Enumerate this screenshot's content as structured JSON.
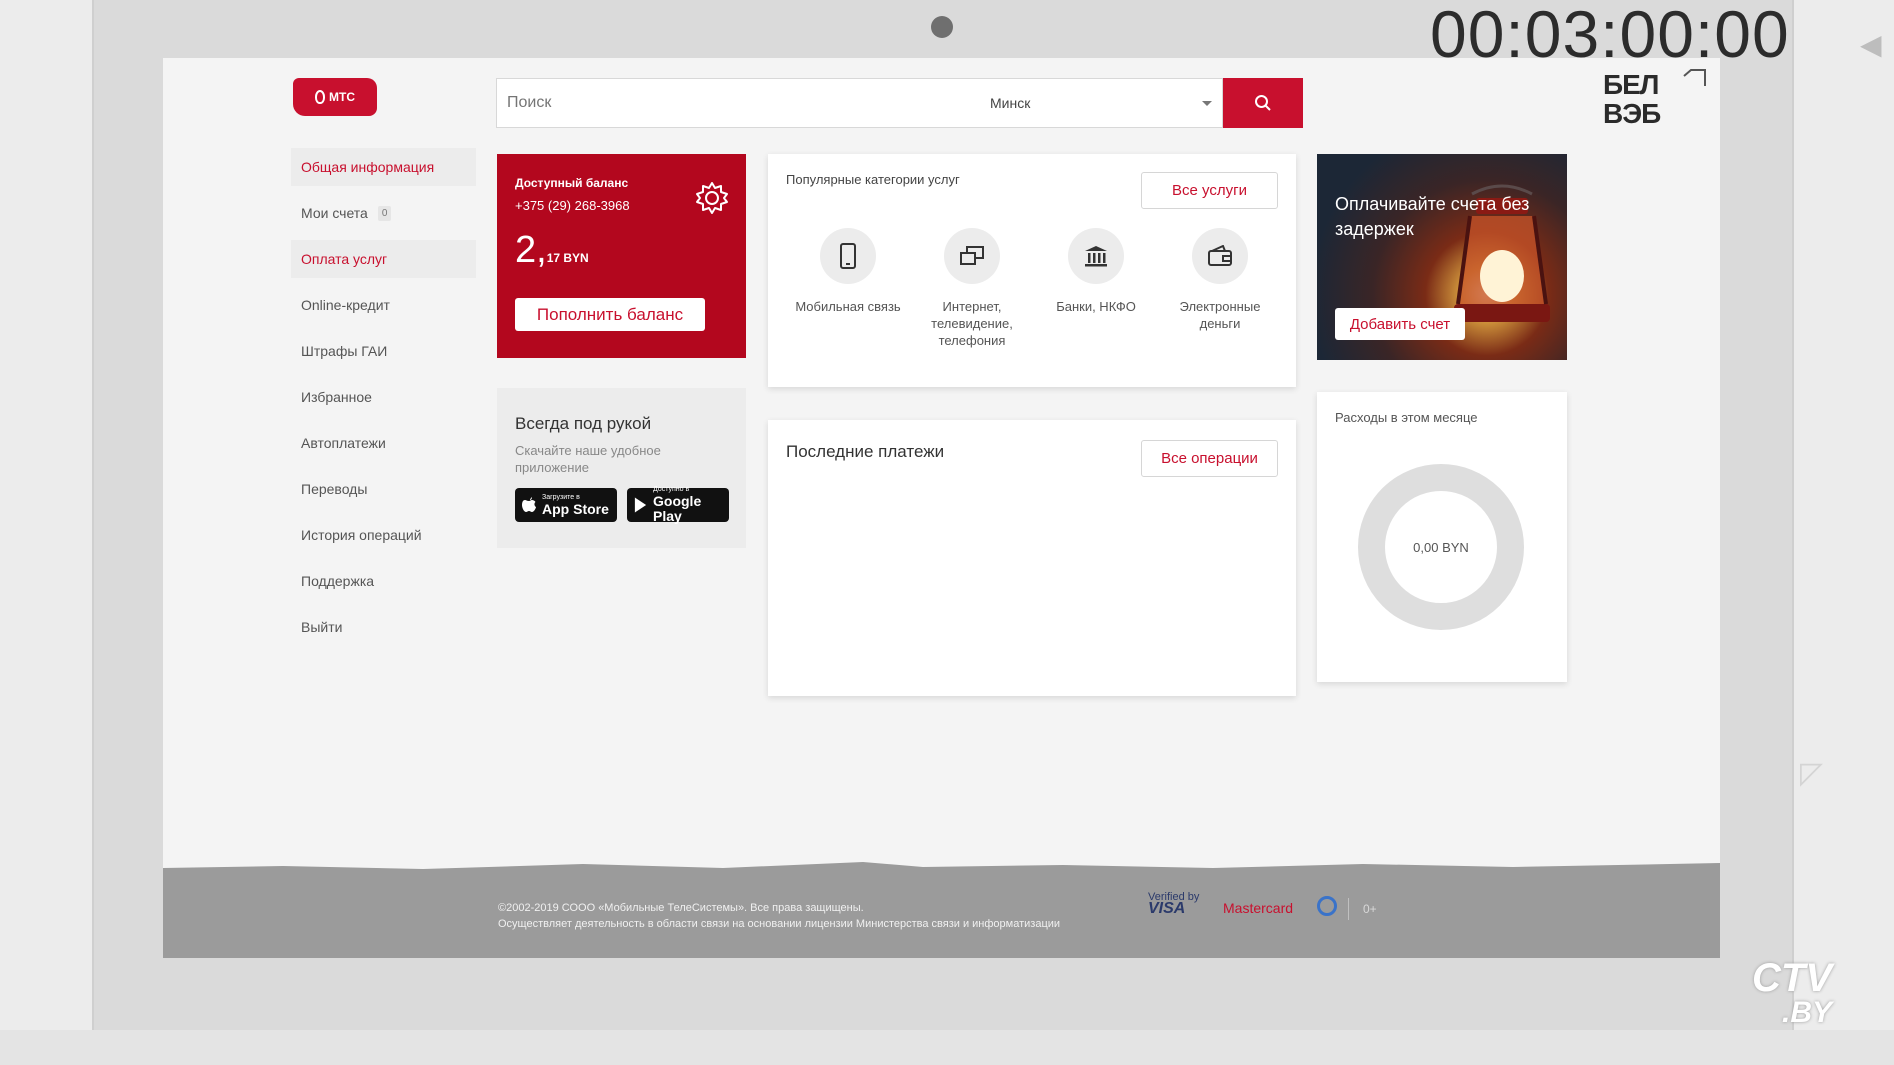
{
  "overlay": {
    "timecode": "00:03:00:00",
    "channel_logo": "CTV",
    "channel_logo_suffix": ".BY"
  },
  "header": {
    "logo_text": "МТС",
    "search_placeholder": "Поиск",
    "city": "Минск",
    "search_icon": "search-icon",
    "partner_logo_line1": "БЕЛ",
    "partner_logo_line2": "ВЭБ"
  },
  "sidebar": {
    "items": [
      {
        "label": "Общая информация",
        "state": "active"
      },
      {
        "label": "Мои счета",
        "badge": "0"
      },
      {
        "label": "Оплата услуг",
        "state": "hover"
      },
      {
        "label": "Online-кредит"
      },
      {
        "label": "Штрафы ГАИ"
      },
      {
        "label": "Избранное"
      },
      {
        "label": "Автоплатежи"
      },
      {
        "label": "Переводы"
      },
      {
        "label": "История операций"
      },
      {
        "label": "Поддержка"
      },
      {
        "label": "Выйти"
      }
    ]
  },
  "balance": {
    "label": "Доступный баланс",
    "phone": "+375 (29) 268-3968",
    "amount_main": "2,",
    "amount_rest": "17 BYN",
    "topup_label": "Пополнить баланс",
    "settings_icon": "gear-icon"
  },
  "app_promo": {
    "title": "Всегда под рукой",
    "subtitle": "Скачайте наше удобное приложение",
    "app_store_small": "Загрузите в",
    "app_store": "App Store",
    "google_play_small": "Доступно в",
    "google_play": "Google Play"
  },
  "popular": {
    "title": "Популярные категории услуг",
    "all_label": "Все услуги",
    "categories": [
      {
        "label": "Мобильная связь",
        "icon": "mobile-phone-icon"
      },
      {
        "label": "Интернет, телевидение, телефония",
        "icon": "internet-tv-icon"
      },
      {
        "label": "Банки, НКФО",
        "icon": "bank-icon"
      },
      {
        "label": "Электронные деньги",
        "icon": "wallet-icon"
      }
    ]
  },
  "promo": {
    "text": "Оплачивайте счета без задержек",
    "button_label": "Добавить счет"
  },
  "payments": {
    "title": "Последние платежи",
    "all_label": "Все операции"
  },
  "expenses": {
    "title": "Расходы в этом месяце",
    "value": "0,00 BYN"
  },
  "footer": {
    "copyright_line1": "©2002-2019 СООО «Мобильные ТелеСистемы». Все права защищены.",
    "copyright_line2": "Осуществляет деятельность в области связи на основании лицензии Министерства связи и информатизации",
    "verified_by": "Verified by",
    "visa": "VISA",
    "mastercard": "Mastercard",
    "age_rating": "0+"
  },
  "colors": {
    "brand_red": "#c8102e",
    "balance_red": "#b3071e",
    "footer_grey": "#9b9b9b"
  }
}
